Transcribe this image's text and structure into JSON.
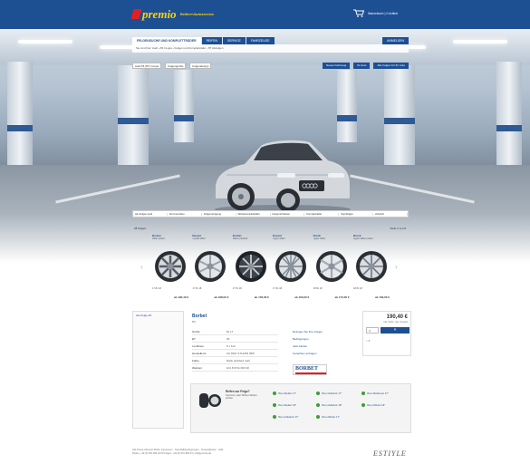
{
  "header": {
    "logo_text": "premio",
    "logo_sub": "Reifen+Autoservice",
    "cart_label": "Warenkorb | 0 Artikel"
  },
  "search": {
    "tabs": [
      {
        "label": "FELGENSUCHE UND KOMPLETTRÄDER"
      },
      {
        "label": "REIFEN"
      },
      {
        "label": "SERVICE"
      },
      {
        "label": "FAHRZEUGE"
      }
    ],
    "login_label": "ANMELDEN",
    "path_text": "Sie sind hier: Audi › A5 Coupe › Felgen und Kompletträder › 8T Alufelgen",
    "filters": [
      "Audi A5 (8T) Coupe",
      "Felgengröße",
      "Felgendesign"
    ],
    "buttons": [
      "Neues Fahrzeug",
      "Ihr Auto",
      "Alle Felgen für Ihr Auto"
    ]
  },
  "categories": [
    "Alu-Felgen Audi",
    "Sommerreifen",
    "Felgenreinigung",
    "Winterkompletträder",
    "Felgenschlösser",
    "Kompletträder",
    "Sportfelgen",
    "Zubehör"
  ],
  "wheels_head": {
    "left": "28 Felgen",
    "right": "Seite 1 von 8"
  },
  "wheels": [
    {
      "brand": "Borbet",
      "name": "silber poliert",
      "spec": "17 8x 18",
      "price": "ab 190,40 €"
    },
    {
      "brand": "Dezent",
      "name": "crystal silber",
      "spec": "17 8x 18",
      "price": "ab 168,00 €"
    },
    {
      "brand": "Borbet",
      "name": "black polished",
      "spec": "17 8x 18",
      "price": "ab 178,00 €"
    },
    {
      "brand": "Dezent",
      "name": "hyper silber",
      "spec": "17 8x 18",
      "price": "ab 160,00 €"
    },
    {
      "brand": "Brock",
      "name": "Hyper silber",
      "spec": "18 8x 18",
      "price": "ab 173,00 €"
    },
    {
      "brand": "Brock",
      "name": "Hyper-silber poliert",
      "spec": "18 8x 18",
      "price": "ab 159,00 €"
    }
  ],
  "sidebar": {
    "title": "Alu-Felge A5"
  },
  "detail": {
    "title": "Borbet",
    "subtitle": "BS",
    "specs": [
      {
        "k": "Größe",
        "v": "8x 17"
      },
      {
        "k": "ET",
        "v": "35"
      },
      {
        "k": "Lochkreis",
        "v": "5 x 112"
      },
      {
        "k": "Herstellernr.",
        "v": "CC 8017 4711253 35/5"
      },
      {
        "k": "Farbe",
        "v": "black polished matt"
      },
      {
        "k": "Werksnr.",
        "v": "101 8 0711 000 30"
      }
    ],
    "links": [
      "Reinigen Sie Ihre Felgen",
      "Bedingungen",
      "Jetzt kaufen",
      "Gutachten anfragen"
    ],
    "brand_logo": "BORBET",
    "price": "190,40 €",
    "price_sub": "inkl. MwSt. zzgl. Versand",
    "qty": "4",
    "cart_btn": "»",
    "availability": "> 8"
  },
  "accessories": {
    "title": "Reifen zur Felge?",
    "text": "Sommer oder Winter Reifen prüfen",
    "links": [
      "Ihren Reifen 17\"",
      "Ihren Zubehör 17\"",
      "Ihren Reifenset 17\"",
      "Ihren Reifen 18\"",
      "Ihren Zubehör 18\"",
      "Ihren Winter 18\"",
      "Ihren Zubehör 17\"",
      "Ihren Winter 17\""
    ]
  },
  "footer": {
    "line1": "Alle Preise inklusive MwSt. Impressum · Geschäftsbedingungen · Versandkosten · Hilfe",
    "line2": "Reifen: +49 (0) 661 869 34 50 Felgen: +49 (0) 661 869 34 | info@premio.de",
    "logo": "ESTIYLE"
  },
  "colors": {
    "brand_blue": "#1d4f93",
    "logo_yellow": "#ffd500",
    "accent_red": "#e31e24",
    "available_green": "#3a9d3a"
  }
}
